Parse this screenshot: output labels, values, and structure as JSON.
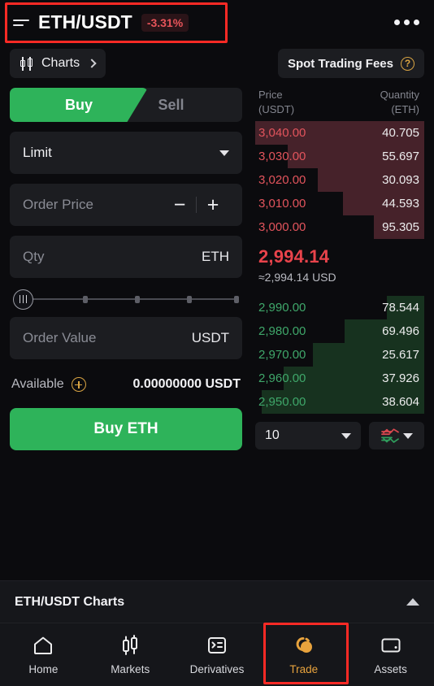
{
  "header": {
    "list_icon": "list-icon",
    "pair": "ETH/USDT",
    "change": "-3.31%",
    "more_icon": "more-options-icon"
  },
  "charts_chip": {
    "icon": "candlestick-icon",
    "label": "Charts",
    "chevron": "chevron-right-icon"
  },
  "order_form": {
    "tabs": {
      "buy": "Buy",
      "sell": "Sell",
      "active": "Buy"
    },
    "order_type": "Limit",
    "order_price": {
      "label": "Order Price",
      "value": "",
      "minus": "−",
      "plus": "+"
    },
    "qty": {
      "label": "Qty",
      "unit": "ETH",
      "value": ""
    },
    "slider": {
      "percent": 0,
      "ticks": [
        25,
        50,
        75,
        100
      ]
    },
    "order_value": {
      "label": "Order Value",
      "unit": "USDT",
      "value": ""
    },
    "available": {
      "label": "Available",
      "value": "0.00000000 USDT",
      "add_icon": "plus-circle-icon"
    },
    "submit": "Buy ETH"
  },
  "orderbook": {
    "fees_button": {
      "label": "Spot Trading Fees",
      "icon": "question-circle-icon"
    },
    "head_price": "Price\n(USDT)",
    "head_price_line1": "Price",
    "head_price_line2": "(USDT)",
    "head_qty_line1": "Quantity",
    "head_qty_line2": "(ETH)",
    "asks": [
      {
        "price": "3,040.00",
        "qty": "40.705",
        "depth": 100
      },
      {
        "price": "3,030.00",
        "qty": "55.697",
        "depth": 81
      },
      {
        "price": "3,020.00",
        "qty": "30.093",
        "depth": 63
      },
      {
        "price": "3,010.00",
        "qty": "44.593",
        "depth": 48
      },
      {
        "price": "3,000.00",
        "qty": "95.305",
        "depth": 30
      }
    ],
    "last_price": "2,994.14",
    "last_price_usd": "≈2,994.14 USD",
    "bids": [
      {
        "price": "2,990.00",
        "qty": "78.544",
        "depth": 22
      },
      {
        "price": "2,980.00",
        "qty": "69.496",
        "depth": 47
      },
      {
        "price": "2,970.00",
        "qty": "25.617",
        "depth": 66
      },
      {
        "price": "2,960.00",
        "qty": "37.926",
        "depth": 83
      },
      {
        "price": "2,950.00",
        "qty": "38.604",
        "depth": 96
      }
    ],
    "grouping": "10",
    "display_mode_icon": "orderbook-mode-icon"
  },
  "charts_section": {
    "title": "ETH/USDT Charts",
    "toggle_icon": "chevron-up-icon"
  },
  "bottom_nav": [
    {
      "label": "Home",
      "icon": "home-icon",
      "active": false
    },
    {
      "label": "Markets",
      "icon": "candlestick-icon",
      "active": false
    },
    {
      "label": "Derivatives",
      "icon": "list-panel-icon",
      "active": false
    },
    {
      "label": "Trade",
      "icon": "coins-icon",
      "active": true
    },
    {
      "label": "Assets",
      "icon": "wallet-icon",
      "active": false
    }
  ],
  "colors": {
    "buy_green": "#2eb35a",
    "sell_red": "#e8434b",
    "accent_orange": "#e8a33d",
    "annotation_red": "#fb2a25",
    "background": "#0b0b0e"
  }
}
